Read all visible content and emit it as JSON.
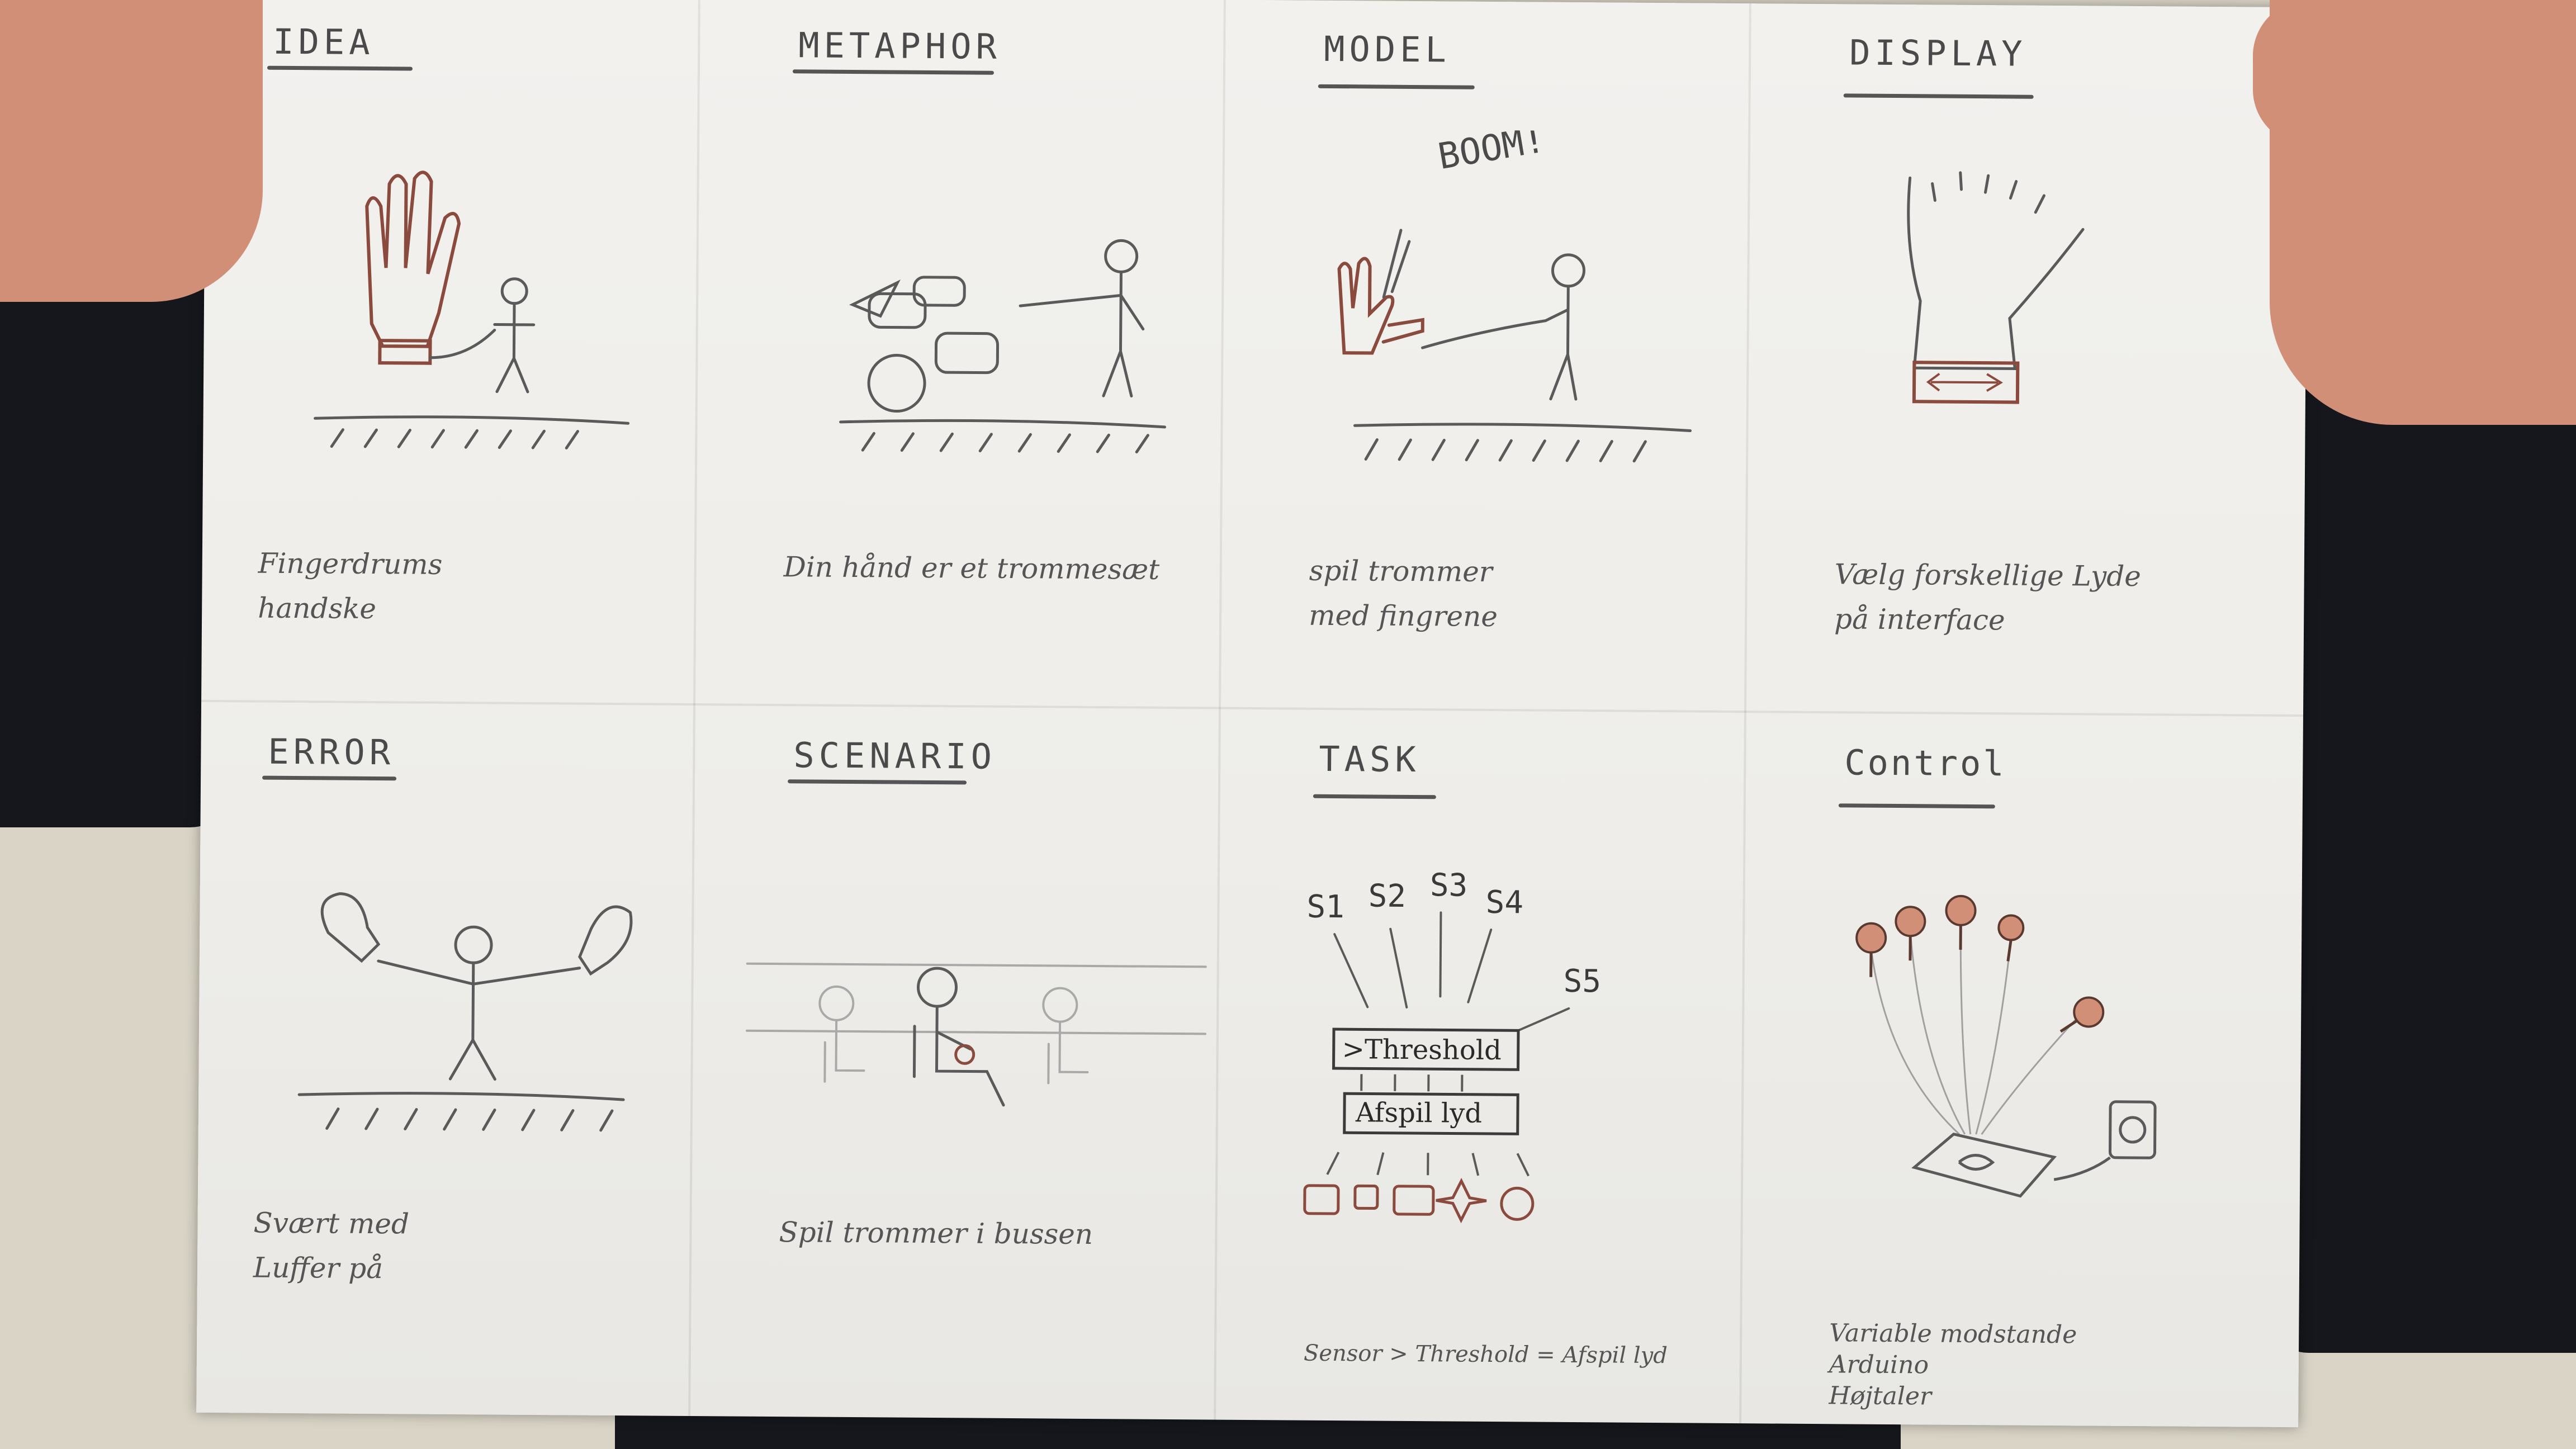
{
  "panels": [
    {
      "title": "IDEA",
      "caption": "Fingerdrums\n        handske"
    },
    {
      "title": "METAPHOR",
      "caption": "Din hånd er et trommesæt"
    },
    {
      "title": "MODEL",
      "caption": "spil trommer\n    med fingrene"
    },
    {
      "title": "DISPLAY",
      "caption": "Vælg forskellige Lyde\n     på interface"
    },
    {
      "title": "ERROR",
      "caption": "Svært med\n   Luffer på"
    },
    {
      "title": "SCENARIO",
      "caption": "Spil trommer i bussen"
    },
    {
      "title": "TASK",
      "caption": "Sensor > Threshold = Afspil lyd"
    },
    {
      "title": "Control",
      "caption": "Variable modstande\nArduino\nHøjtaler"
    }
  ],
  "model_sketch": {
    "exclamation": "BOOM!"
  },
  "task_sketch": {
    "sensors": [
      "S1",
      "S2",
      "S3",
      "S4",
      "S5"
    ],
    "threshold_box": ">Threshold",
    "play_box": "Afspil lyd"
  },
  "colors": {
    "pencil": "#5a5a5a",
    "red_pencil": "#8a4a3e",
    "paper": "#eeede9",
    "sweater": "#16171c"
  }
}
